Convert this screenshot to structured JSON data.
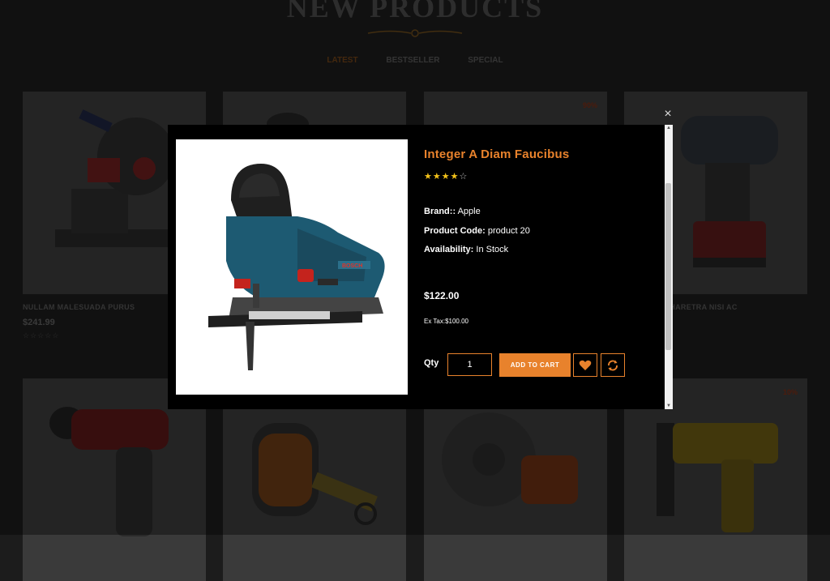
{
  "section": {
    "title": "NEW PRODUCTS",
    "tabs": [
      {
        "label": "LATEST",
        "active": true
      },
      {
        "label": "BESTSELLER",
        "active": false
      },
      {
        "label": "SPECIAL",
        "active": false
      }
    ]
  },
  "cards": [
    {
      "name": "NULLAM MALESUADA PURUS",
      "price": "$241.99",
      "stars": "☆☆☆☆☆",
      "badge": ""
    },
    {
      "name": "",
      "price": "",
      "stars": "",
      "badge": ""
    },
    {
      "name": "",
      "price": "",
      "stars": "",
      "badge": "90%"
    },
    {
      "name": "PHARETRA NISI AC",
      "price": "",
      "stars": "",
      "badge": ""
    },
    {
      "name": "",
      "price": "",
      "stars": "",
      "badge": ""
    },
    {
      "name": "",
      "price": "",
      "stars": "",
      "badge": ""
    },
    {
      "name": "",
      "price": "",
      "stars": "",
      "badge": ""
    },
    {
      "name": "",
      "price": "",
      "stars": "",
      "badge": "10%"
    }
  ],
  "modal": {
    "close": "×",
    "product_title": "Integer A Diam Faucibus",
    "rating": 4,
    "rating_max": 5,
    "brand_label": "Brand::",
    "brand_value": "Apple",
    "code_label": "Product Code:",
    "code_value": "product 20",
    "availability_label": "Availability:",
    "availability_value": "In Stock",
    "price": "$122.00",
    "ex_tax": "Ex Tax:$100.00",
    "qty_label": "Qty",
    "qty_value": "1",
    "add_to_cart": "ADD TO CART",
    "wishlist_icon": "heart-icon",
    "compare_icon": "refresh-icon"
  },
  "colors": {
    "accent": "#e8822c",
    "star": "#f3c21a",
    "modal_bg": "#000000"
  }
}
